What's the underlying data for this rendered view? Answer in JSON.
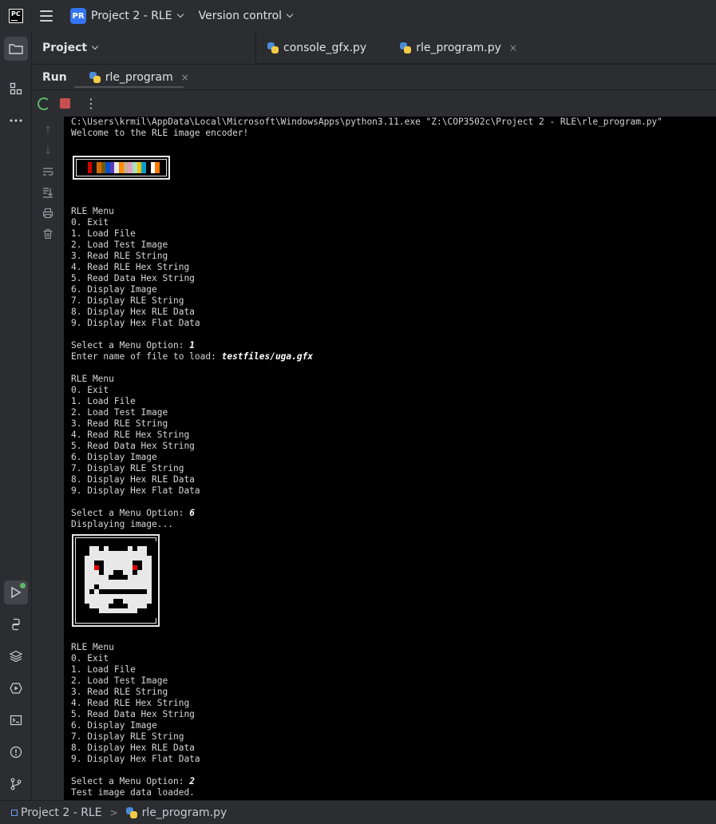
{
  "titlebar": {
    "app_logo": "PC",
    "project_badge": "PR",
    "project_name": "Project 2 - RLE",
    "vcs_label": "Version control"
  },
  "project_panel": {
    "title": "Project"
  },
  "editor_tabs": [
    {
      "label": "console_gfx.py"
    },
    {
      "label": "rle_program.py",
      "close": "×"
    }
  ],
  "run_panel": {
    "title": "Run",
    "tab_label": "rle_program",
    "tab_close": "×"
  },
  "console": {
    "header_lines": [
      "C:\\Users\\krmil\\AppData\\Local\\Microsoft\\WindowsApps\\python3.11.exe \"Z:\\COP3502c\\Project 2 - RLE\\rle_program.py\"",
      "Welcome to the RLE image encoder!"
    ],
    "menu": [
      "RLE Menu",
      "0. Exit",
      "1. Load File",
      "2. Load Test Image",
      "3. Read RLE String",
      "4. Read RLE Hex String",
      "5. Read Data Hex String",
      "6. Display Image",
      "7. Display RLE String",
      "8. Display Hex RLE Data",
      "9. Display Hex Flat Data"
    ],
    "prompt_option": "Select a Menu Option: ",
    "prompt_file": "Enter name of file to load: ",
    "input1": "1",
    "input_file": "testfiles/uga.gfx",
    "input2": "6",
    "displaying": "Displaying image...",
    "input3": "2",
    "loaded": "Test image data loaded."
  },
  "colors": {
    "colorbar": [
      "#000000",
      "#d40000",
      "#111111",
      "#d46a00",
      "#7a5a00",
      "#0050c8",
      "#5a3ab8",
      "#e8e8e8",
      "#ff8a00",
      "#c8b090",
      "#e0a0c0",
      "#a8e0c0",
      "#f5c000",
      "#00a0d0",
      "#000000",
      "#ffffff",
      "#ff7a00"
    ]
  },
  "statusbar": {
    "project": "Project 2 - RLE",
    "separator": ">",
    "file": "rle_program.py"
  }
}
